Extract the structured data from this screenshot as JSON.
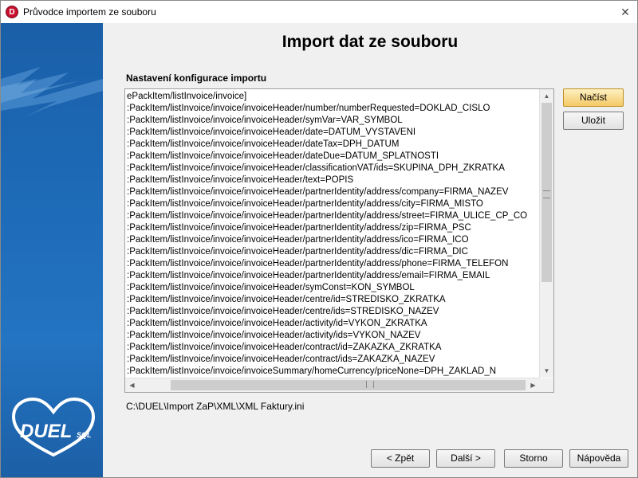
{
  "window": {
    "title": "Průvodce importem ze souboru",
    "close_glyph": "✕",
    "app_icon": "D"
  },
  "logo": {
    "brand": "DUEL",
    "suffix": "SQL"
  },
  "page": {
    "heading": "Import dat ze souboru",
    "config_label": "Nastavení konfigurace importu",
    "file_path": "C:\\DUEL\\Import ZaP\\XML\\XML Faktury.ini"
  },
  "config_lines": [
    "ePackItem/listInvoice/invoice]",
    ":PackItem/listInvoice/invoice/invoiceHeader/number/numberRequested=DOKLAD_CISLO",
    ":PackItem/listInvoice/invoice/invoiceHeader/symVar=VAR_SYMBOL",
    ":PackItem/listInvoice/invoice/invoiceHeader/date=DATUM_VYSTAVENI",
    ":PackItem/listInvoice/invoice/invoiceHeader/dateTax=DPH_DATUM",
    ":PackItem/listInvoice/invoice/invoiceHeader/dateDue=DATUM_SPLATNOSTI",
    ":PackItem/listInvoice/invoice/invoiceHeader/classificationVAT/ids=SKUPINA_DPH_ZKRATKA",
    ":PackItem/listInvoice/invoice/invoiceHeader/text=POPIS",
    ":PackItem/listInvoice/invoice/invoiceHeader/partnerIdentity/address/company=FIRMA_NAZEV",
    ":PackItem/listInvoice/invoice/invoiceHeader/partnerIdentity/address/city=FIRMA_MISTO",
    ":PackItem/listInvoice/invoice/invoiceHeader/partnerIdentity/address/street=FIRMA_ULICE_CP_CO",
    ":PackItem/listInvoice/invoice/invoiceHeader/partnerIdentity/address/zip=FIRMA_PSC",
    ":PackItem/listInvoice/invoice/invoiceHeader/partnerIdentity/address/ico=FIRMA_ICO",
    ":PackItem/listInvoice/invoice/invoiceHeader/partnerIdentity/address/dic=FIRMA_DIC",
    ":PackItem/listInvoice/invoice/invoiceHeader/partnerIdentity/address/phone=FIRMA_TELEFON",
    ":PackItem/listInvoice/invoice/invoiceHeader/partnerIdentity/address/email=FIRMA_EMAIL",
    ":PackItem/listInvoice/invoice/invoiceHeader/symConst=KON_SYMBOL",
    ":PackItem/listInvoice/invoice/invoiceHeader/centre/id=STREDISKO_ZKRATKA",
    ":PackItem/listInvoice/invoice/invoiceHeader/centre/ids=STREDISKO_NAZEV",
    ":PackItem/listInvoice/invoice/invoiceHeader/activity/id=VYKON_ZKRATKA",
    ":PackItem/listInvoice/invoice/invoiceHeader/activity/ids=VYKON_NAZEV",
    ":PackItem/listInvoice/invoice/invoiceHeader/contract/id=ZAKAZKA_ZKRATKA",
    ":PackItem/listInvoice/invoice/invoiceHeader/contract/ids=ZAKAZKA_NAZEV",
    ":PackItem/listInvoice/invoice/invoiceSummary/homeCurrency/priceNone=DPH_ZAKLAD_N"
  ],
  "side_buttons": {
    "load": "Načíst",
    "save": "Uložit"
  },
  "footer_buttons": {
    "back": "< Zpět",
    "next": "Další >",
    "cancel": "Storno",
    "help": "Nápověda"
  },
  "scroll": {
    "up": "▲",
    "down": "▼",
    "left": "◀",
    "right": "▶"
  },
  "colors": {
    "sidebar": "#1e6bb8",
    "logo_red": "#c8102e",
    "primary_button": "#f5c966"
  },
  "icons": {
    "app": "duel-app-icon",
    "close": "close-icon",
    "logo": "duel-logo-icon"
  }
}
